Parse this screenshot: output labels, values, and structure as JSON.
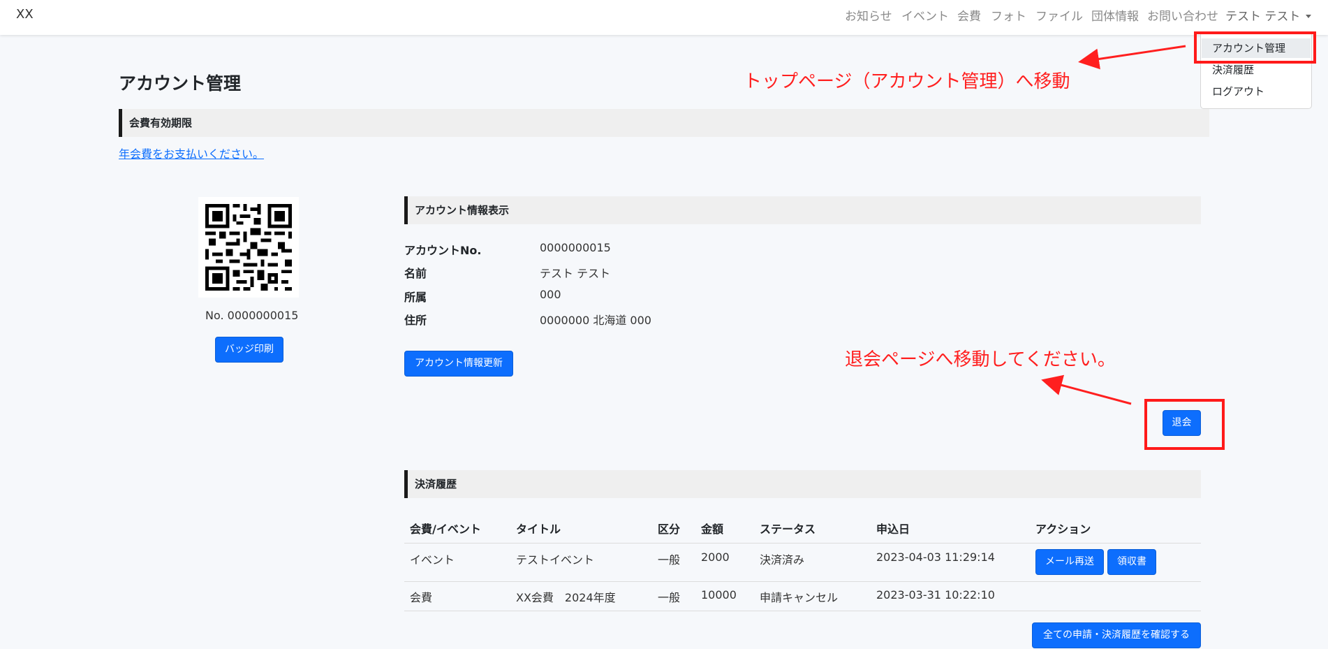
{
  "navbar": {
    "brand": "XX",
    "items": [
      "お知らせ",
      "イベント",
      "会費",
      "フォト",
      "ファイル",
      "団体情報",
      "お問い合わせ"
    ],
    "user": "テスト テスト"
  },
  "dropdown": {
    "items": [
      "アカウント管理",
      "決済履歴",
      "ログアウト"
    ]
  },
  "page_title": "アカウント管理",
  "membership": {
    "heading": "会費有効期限",
    "link": "年会費をお支払いください。"
  },
  "badge": {
    "number_text": "No. 0000000015",
    "print_button": "バッジ印刷"
  },
  "account_info": {
    "heading": "アカウント情報表示",
    "rows": [
      {
        "label": "アカウントNo.",
        "value": "0000000015"
      },
      {
        "label": "名前",
        "value": "テスト テスト"
      },
      {
        "label": "所属",
        "value": "000"
      },
      {
        "label": "住所",
        "value": "0000000 北海道 000"
      }
    ],
    "update_button": "アカウント情報更新",
    "withdraw_button": "退会"
  },
  "payments": {
    "heading": "決済履歴",
    "columns": [
      "会費/イベント",
      "タイトル",
      "区分",
      "金額",
      "ステータス",
      "申込日",
      "アクション"
    ],
    "rows": [
      {
        "type": "イベント",
        "title": "テストイベント",
        "category": "一般",
        "amount": "2000",
        "status": "決済済み",
        "date": "2023-04-03 11:29:14",
        "actions": [
          "メール再送",
          "領収書"
        ]
      },
      {
        "type": "会費",
        "title": "XX会費　2024年度",
        "category": "一般",
        "amount": "10000",
        "status": "申請キャンセル",
        "date": "2023-03-31 10:22:10",
        "actions": []
      }
    ],
    "all_button": "全ての申請・決済履歴を確認する"
  },
  "annotations": {
    "top_note": "トップページ（アカウント管理）へ移動",
    "withdraw_note": "退会ページへ移動してください。",
    "color": "#ff1f1f"
  },
  "colors": {
    "primary": "#0d6efd",
    "background": "#f6f8fb"
  }
}
